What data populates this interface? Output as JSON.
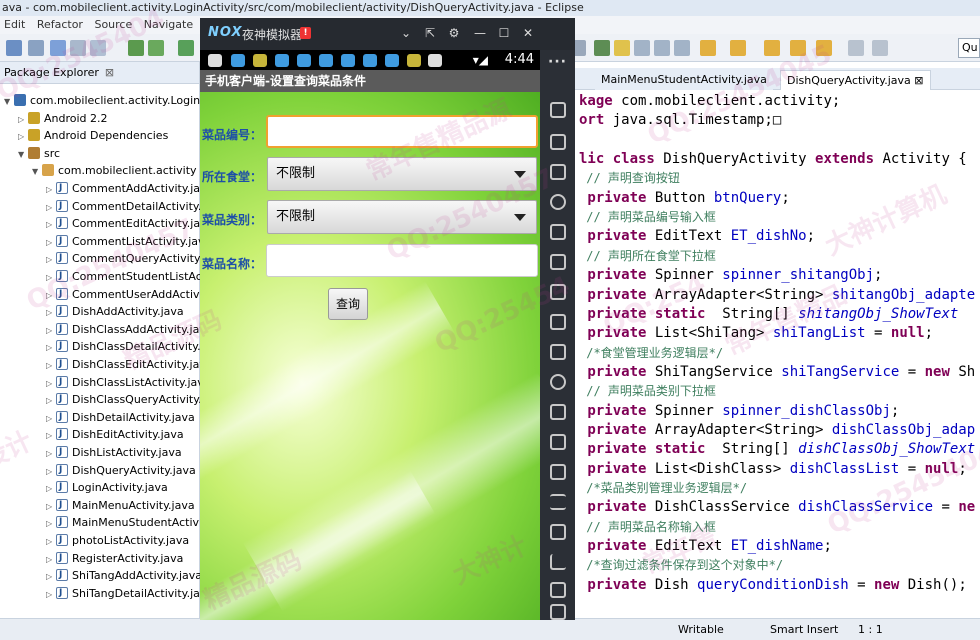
{
  "window": {
    "title": "ava - com.mobileclient.activity.LoginActivity/src/com/mobileclient/activity/DishQueryActivity.java - Eclipse"
  },
  "menubar": [
    "Edit",
    "Refactor",
    "Source",
    "Navigate"
  ],
  "quick_access": "Qu",
  "package_explorer": {
    "tab_label": "Package Explorer",
    "close_glyph": "⊠",
    "tree": [
      {
        "label": "com.mobileclient.activity.LoginActivity",
        "level": 0,
        "icon": "project-icon"
      },
      {
        "label": "Android 2.2",
        "level": 1,
        "icon": "library-icon"
      },
      {
        "label": "Android Dependencies",
        "level": 1,
        "icon": "library-icon"
      },
      {
        "label": "src",
        "level": 1,
        "icon": "source-folder-icon"
      },
      {
        "label": "com.mobileclient.activity",
        "level": 2,
        "icon": "package-icon"
      },
      {
        "label": "CommentAddActivity.java",
        "level": 3,
        "icon": "java-file-icon"
      },
      {
        "label": "CommentDetailActivity.ja",
        "level": 3,
        "icon": "java-file-icon"
      },
      {
        "label": "CommentEditActivity.java",
        "level": 3,
        "icon": "java-file-icon"
      },
      {
        "label": "CommentListActivity.java",
        "level": 3,
        "icon": "java-file-icon"
      },
      {
        "label": "CommentQueryActivity.ja",
        "level": 3,
        "icon": "java-file-icon"
      },
      {
        "label": "CommentStudentListActi",
        "level": 3,
        "icon": "java-file-icon"
      },
      {
        "label": "CommentUserAddActivit",
        "level": 3,
        "icon": "java-file-icon"
      },
      {
        "label": "DishAddActivity.java",
        "level": 3,
        "icon": "java-file-icon"
      },
      {
        "label": "DishClassAddActivity.jav",
        "level": 3,
        "icon": "java-file-icon"
      },
      {
        "label": "DishClassDetailActivity.ja",
        "level": 3,
        "icon": "java-file-icon"
      },
      {
        "label": "DishClassEditActivity.java",
        "level": 3,
        "icon": "java-file-icon"
      },
      {
        "label": "DishClassListActivity.java",
        "level": 3,
        "icon": "java-file-icon"
      },
      {
        "label": "DishClassQueryActivity.ja",
        "level": 3,
        "icon": "java-file-icon"
      },
      {
        "label": "DishDetailActivity.java",
        "level": 3,
        "icon": "java-file-icon"
      },
      {
        "label": "DishEditActivity.java",
        "level": 3,
        "icon": "java-file-icon"
      },
      {
        "label": "DishListActivity.java",
        "level": 3,
        "icon": "java-file-icon"
      },
      {
        "label": "DishQueryActivity.java",
        "level": 3,
        "icon": "java-file-icon"
      },
      {
        "label": "LoginActivity.java",
        "level": 3,
        "icon": "java-file-icon"
      },
      {
        "label": "MainMenuActivity.java",
        "level": 3,
        "icon": "java-file-icon"
      },
      {
        "label": "MainMenuStudentActivit",
        "level": 3,
        "icon": "java-file-icon"
      },
      {
        "label": "photoListActivity.java",
        "level": 3,
        "icon": "java-file-icon"
      },
      {
        "label": "RegisterActivity.java",
        "level": 3,
        "icon": "java-file-icon"
      },
      {
        "label": "ShiTangAddActivity.java",
        "level": 3,
        "icon": "java-file-icon"
      },
      {
        "label": "ShiTangDetailActivity.jav",
        "level": 3,
        "icon": "java-file-icon"
      }
    ]
  },
  "editor": {
    "tabs": [
      {
        "label": "MainMenuStudentActivity.java"
      },
      {
        "label": "DishQueryActivity.java",
        "close_glyph": "⊠"
      }
    ],
    "code_lines": [
      {
        "segments": [
          {
            "t": "kage ",
            "c": "kw"
          },
          {
            "t": "com.mobileclient.activity;",
            "c": ""
          }
        ]
      },
      {
        "segments": [
          {
            "t": "ort ",
            "c": "kw"
          },
          {
            "t": "java.sql.Timestamp;",
            "c": ""
          },
          {
            "t": "□",
            "c": ""
          }
        ]
      },
      {
        "segments": [
          {
            "t": "",
            "c": ""
          }
        ]
      },
      {
        "segments": [
          {
            "t": "lic ",
            "c": "kw"
          },
          {
            "t": "class ",
            "c": "kw"
          },
          {
            "t": "DishQueryActivity ",
            "c": ""
          },
          {
            "t": "extends ",
            "c": "kw"
          },
          {
            "t": "Activity {",
            "c": ""
          }
        ]
      },
      {
        "segments": [
          {
            "t": " // 声明查询按钮",
            "c": "cmt"
          }
        ]
      },
      {
        "segments": [
          {
            "t": " private ",
            "c": "kw"
          },
          {
            "t": "Button ",
            "c": ""
          },
          {
            "t": "btnQuery",
            "c": "field"
          },
          {
            "t": ";",
            "c": ""
          }
        ]
      },
      {
        "segments": [
          {
            "t": " // 声明菜品编号输入框",
            "c": "cmt"
          }
        ]
      },
      {
        "segments": [
          {
            "t": " private ",
            "c": "kw"
          },
          {
            "t": "EditText ",
            "c": ""
          },
          {
            "t": "ET_dishNo",
            "c": "field"
          },
          {
            "t": ";",
            "c": ""
          }
        ]
      },
      {
        "segments": [
          {
            "t": " // 声明所在食堂下拉框",
            "c": "cmt"
          }
        ]
      },
      {
        "segments": [
          {
            "t": " private ",
            "c": "kw"
          },
          {
            "t": "Spinner ",
            "c": ""
          },
          {
            "t": "spinner_shitangObj",
            "c": "field"
          },
          {
            "t": ";",
            "c": ""
          }
        ]
      },
      {
        "segments": [
          {
            "t": " private ",
            "c": "kw"
          },
          {
            "t": "ArrayAdapter<String> ",
            "c": ""
          },
          {
            "t": "shitangObj_adapte",
            "c": "field"
          }
        ]
      },
      {
        "segments": [
          {
            "t": " private ",
            "c": "kw"
          },
          {
            "t": "static ",
            "c": "kw"
          },
          {
            "t": " String[] ",
            "c": ""
          },
          {
            "t": "shitangObj_ShowText",
            "c": "field ital"
          }
        ]
      },
      {
        "segments": [
          {
            "t": " private ",
            "c": "kw"
          },
          {
            "t": "List<ShiTang> ",
            "c": ""
          },
          {
            "t": "shiTangList",
            "c": "field"
          },
          {
            "t": " = ",
            "c": ""
          },
          {
            "t": "null",
            "c": "kw"
          },
          {
            "t": ";",
            "c": ""
          }
        ]
      },
      {
        "segments": [
          {
            "t": " /*食堂管理业务逻辑层*/",
            "c": "cmt"
          }
        ]
      },
      {
        "segments": [
          {
            "t": " private ",
            "c": "kw"
          },
          {
            "t": "ShiTangService ",
            "c": ""
          },
          {
            "t": "shiTangService",
            "c": "field"
          },
          {
            "t": " = ",
            "c": ""
          },
          {
            "t": "new ",
            "c": "kw"
          },
          {
            "t": "Sh",
            "c": ""
          }
        ]
      },
      {
        "segments": [
          {
            "t": " // 声明菜品类别下拉框",
            "c": "cmt"
          }
        ]
      },
      {
        "segments": [
          {
            "t": " private ",
            "c": "kw"
          },
          {
            "t": "Spinner ",
            "c": ""
          },
          {
            "t": "spinner_dishClassObj",
            "c": "field"
          },
          {
            "t": ";",
            "c": ""
          }
        ]
      },
      {
        "segments": [
          {
            "t": " private ",
            "c": "kw"
          },
          {
            "t": "ArrayAdapter<String> ",
            "c": ""
          },
          {
            "t": "dishClassObj_adap",
            "c": "field"
          }
        ]
      },
      {
        "segments": [
          {
            "t": " private ",
            "c": "kw"
          },
          {
            "t": "static ",
            "c": "kw"
          },
          {
            "t": " String[] ",
            "c": ""
          },
          {
            "t": "dishClassObj_ShowText",
            "c": "field ital"
          }
        ]
      },
      {
        "segments": [
          {
            "t": " private ",
            "c": "kw"
          },
          {
            "t": "List<DishClass> ",
            "c": ""
          },
          {
            "t": "dishClassList",
            "c": "field"
          },
          {
            "t": " = ",
            "c": ""
          },
          {
            "t": "null",
            "c": "kw"
          },
          {
            "t": ";",
            "c": ""
          }
        ]
      },
      {
        "segments": [
          {
            "t": " /*菜品类别管理业务逻辑层*/",
            "c": "cmt"
          }
        ]
      },
      {
        "segments": [
          {
            "t": " private ",
            "c": "kw"
          },
          {
            "t": "DishClassService ",
            "c": ""
          },
          {
            "t": "dishClassService",
            "c": "field"
          },
          {
            "t": " = ",
            "c": ""
          },
          {
            "t": "ne",
            "c": "kw"
          }
        ]
      },
      {
        "segments": [
          {
            "t": " // 声明菜品名称输入框",
            "c": "cmt"
          }
        ]
      },
      {
        "segments": [
          {
            "t": " private ",
            "c": "kw"
          },
          {
            "t": "EditText ",
            "c": ""
          },
          {
            "t": "ET_dishName",
            "c": "field"
          },
          {
            "t": ";",
            "c": ""
          }
        ]
      },
      {
        "segments": [
          {
            "t": " /*查询过滤条件保存到这个对象中*/",
            "c": "cmt"
          }
        ]
      },
      {
        "segments": [
          {
            "t": " private ",
            "c": "kw"
          },
          {
            "t": "Dish ",
            "c": ""
          },
          {
            "t": "queryConditionDish",
            "c": "field"
          },
          {
            "t": " = ",
            "c": ""
          },
          {
            "t": "new ",
            "c": "kw"
          },
          {
            "t": "Dish();",
            "c": ""
          }
        ]
      }
    ]
  },
  "statusbar": {
    "writable": "Writable",
    "insert_mode": "Smart Insert",
    "cursor_position": "1 : 1"
  },
  "emulator": {
    "logo": "NOX",
    "name": "夜神模拟器",
    "alert_glyph": "!",
    "window_controls": [
      "⌄",
      "⇱",
      "⚙",
      "—",
      "☐",
      "✕"
    ],
    "android_status": {
      "time": "4:44",
      "signal": "▾◢"
    },
    "sidebar_menu_glyph": "···",
    "app": {
      "title": "手机客户端-设置查询菜品条件",
      "fields": {
        "dish_no_label": "菜品编号：",
        "dish_no_value": "",
        "canteen_label": "所在食堂：",
        "canteen_value": "不限制",
        "category_label": "菜品类别：",
        "category_value": "不限制",
        "dish_name_label": "菜品名称：",
        "dish_name_value": ""
      },
      "query_button": "查询"
    }
  },
  "watermarks": [
    "QQ:2545404",
    "常年售精品源",
    "QQ:25454045",
    "大神计算机",
    "QQ:2540457",
    "QQ:254",
    "设计",
    "精品源码",
    "QQ:25454",
    "常年售",
    "QQ:25454045",
    "QQ:2540457",
    "精品源码",
    "大神计",
    "常年售精品"
  ],
  "colors": {
    "keyword": "#7f0055",
    "field": "#0000c0",
    "comment": "#3f7f5f",
    "form_label": "#1d4fa8",
    "focus_border": "#f0a030",
    "app_bg_green": "#7fd23a"
  }
}
